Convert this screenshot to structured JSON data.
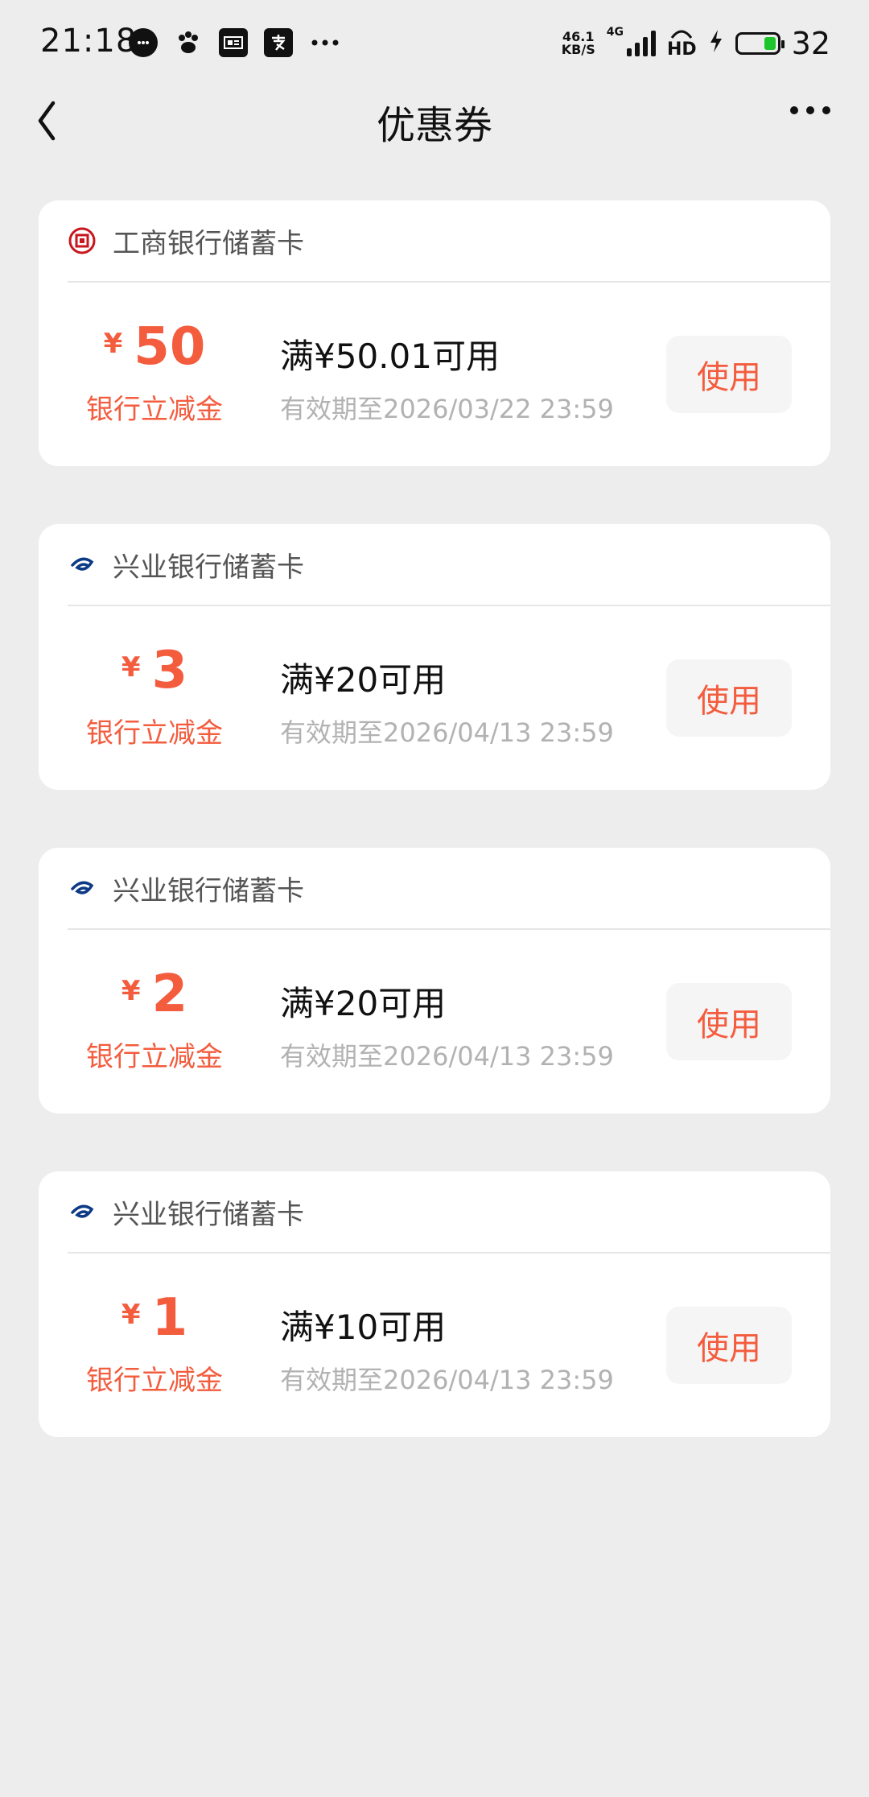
{
  "status_bar": {
    "time": "21:18",
    "net_speed_value": "46.1",
    "net_speed_unit": "KB/S",
    "network": "4G",
    "hd": "HD",
    "battery": "32",
    "battery_level_percent": 32
  },
  "nav": {
    "title": "优惠券"
  },
  "coupons": [
    {
      "bank": "工商银行储蓄卡",
      "bank_logo_icon": "icbc-logo-icon",
      "amount": "50",
      "currency": "¥",
      "type_label": "银行立减金",
      "threshold": "满¥50.01可用",
      "expiry": "有效期至2026/03/22 23:59",
      "button": "使用"
    },
    {
      "bank": "兴业银行储蓄卡",
      "bank_logo_icon": "cib-logo-icon",
      "amount": "3",
      "currency": "¥",
      "type_label": "银行立减金",
      "threshold": "满¥20可用",
      "expiry": "有效期至2026/04/13 23:59",
      "button": "使用"
    },
    {
      "bank": "兴业银行储蓄卡",
      "bank_logo_icon": "cib-logo-icon",
      "amount": "2",
      "currency": "¥",
      "type_label": "银行立减金",
      "threshold": "满¥20可用",
      "expiry": "有效期至2026/04/13 23:59",
      "button": "使用"
    },
    {
      "bank": "兴业银行储蓄卡",
      "bank_logo_icon": "cib-logo-icon",
      "amount": "1",
      "currency": "¥",
      "type_label": "银行立减金",
      "threshold": "满¥10可用",
      "expiry": "有效期至2026/04/13 23:59",
      "button": "使用"
    }
  ],
  "colors": {
    "accent": "#f45c3e",
    "background": "#ededed",
    "card": "#ffffff",
    "muted_text": "#b2b2b2"
  }
}
